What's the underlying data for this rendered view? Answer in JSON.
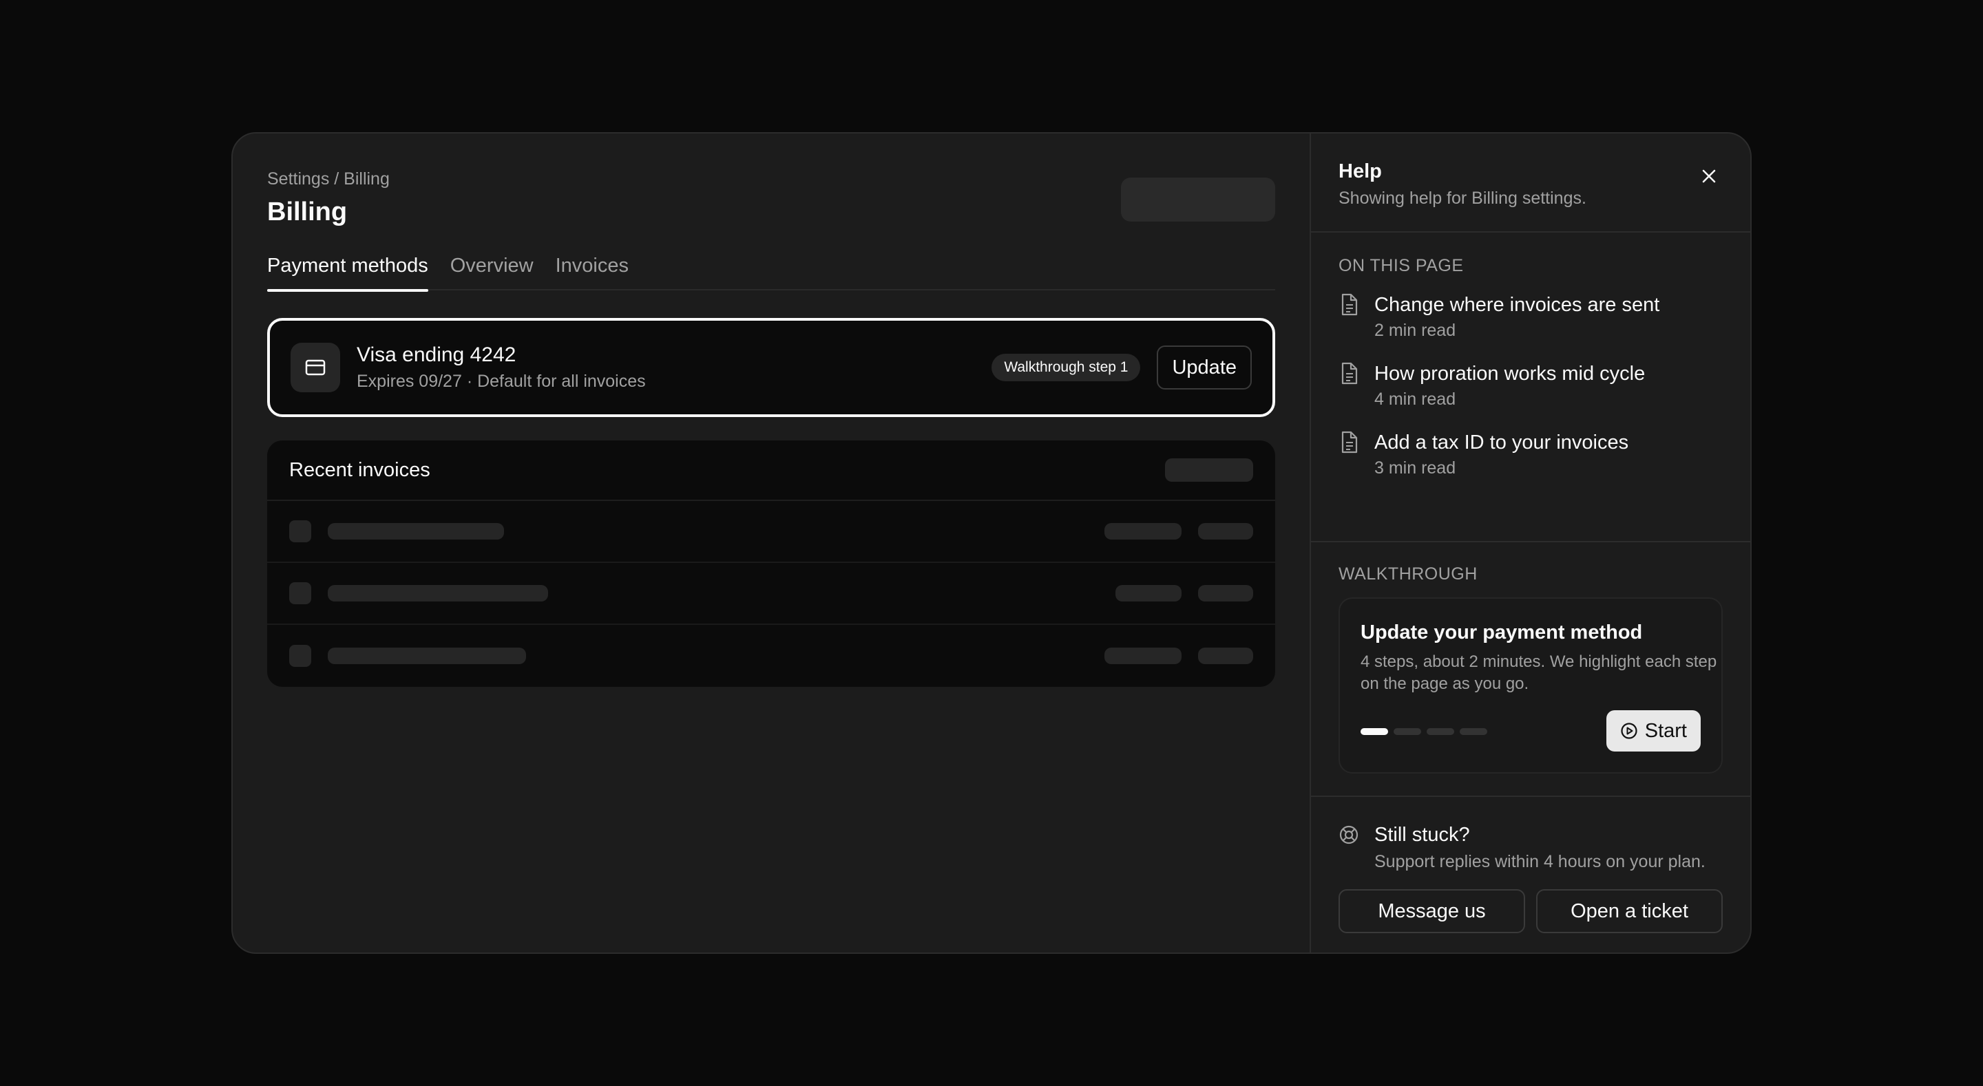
{
  "main": {
    "breadcrumb": "Settings / Billing",
    "title": "Billing",
    "tabs": [
      {
        "label": "Payment methods",
        "active": true
      },
      {
        "label": "Overview",
        "active": false
      },
      {
        "label": "Invoices",
        "active": false
      }
    ],
    "payment_card": {
      "title": "Visa ending 4242",
      "subtitle": "Expires 09/27 · Default for all invoices",
      "badge": "Walkthrough step 1",
      "button": "Update",
      "icon": "credit-card-icon"
    },
    "invoices": {
      "title": "Recent invoices"
    }
  },
  "help": {
    "title": "Help",
    "subtitle": "Showing help for Billing settings.",
    "on_this_page_label": "ON THIS PAGE",
    "articles": [
      {
        "title": "Change where invoices are sent",
        "meta": "2 min read"
      },
      {
        "title": "How proration works mid cycle",
        "meta": "4 min read"
      },
      {
        "title": "Add a tax ID to your invoices",
        "meta": "3 min read"
      }
    ],
    "walkthrough": {
      "label": "WALKTHROUGH",
      "title": "Update your payment method",
      "description": "4 steps, about 2 minutes. We highlight each step on the page as you go.",
      "steps_total": 4,
      "steps_done": 1,
      "start_label": "Start"
    },
    "support": {
      "title": "Still stuck?",
      "subtitle": "Support replies within 4 hours on your plan.",
      "message_label": "Message us",
      "ticket_label": "Open a ticket"
    }
  },
  "colors": {
    "background": "#0a0a0a",
    "panel": "#1c1c1c",
    "text": "#fafafa",
    "muted": "#a1a1a1"
  }
}
